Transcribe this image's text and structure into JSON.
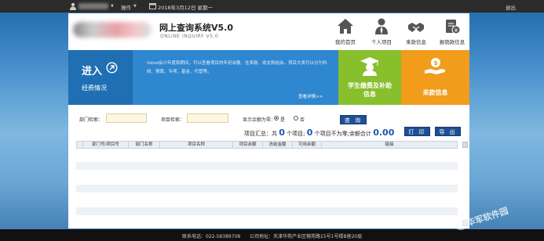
{
  "topbar": {
    "operate_label": "操作",
    "date": "2018年3月12日 星期一",
    "logout_label": "退出"
  },
  "header": {
    "title": "网上查询系统V5.0",
    "subtitle": "ONLINE INQUIRY V5.0",
    "nav": [
      {
        "label": "我的首页",
        "icon": "home-icon"
      },
      {
        "label": "个人项目",
        "icon": "person-icon"
      },
      {
        "label": "来款信息",
        "icon": "handshake-icon"
      },
      {
        "label": "报销款信息",
        "icon": "receipt-icon"
      }
    ]
  },
  "banner": {
    "enter_label": "进入",
    "section_label": "经费情况",
    "description": "listed会计年度和期间，可以查看项目的年初余额、往来款、收支和结余。项目大类可以分为科研、预算、专项、基金、代管等。",
    "more_label": "查看详情>>",
    "tiles": [
      {
        "label": "学生缴费及补助信息",
        "color": "#88bf2c",
        "icon": "graduate-icon"
      },
      {
        "label": "来款信息",
        "color": "#f19c1b",
        "icon": "money-hand-icon"
      }
    ]
  },
  "filters": {
    "dept_label": "部门检索：",
    "dept_value": "",
    "project_label": "项目检索：",
    "project_value": "",
    "zero_label": "显示余额为零：",
    "yes_label": "是",
    "no_label": "否",
    "selected": "是",
    "query_button": "查 询",
    "print_button": "打 印",
    "export_button": "导 出"
  },
  "summary": {
    "prefix": "项目汇总：共",
    "count": "0",
    "mid": "个项目;",
    "zero_count": "0",
    "mid2": "个项目不为零;余额合计",
    "total": "0.00",
    "suffix": "。"
  },
  "table": {
    "columns": [
      "部门号/项目号",
      "部门名称",
      "项目名称",
      "项目余额",
      "冻结金额",
      "可用余额",
      "链接"
    ],
    "rows": []
  },
  "footer": {
    "phone": "联系电话：022-58389708",
    "address": "公司地址：天津华苑产业区榕苑路15号1号楼B座20层"
  },
  "watermark": "华军软件园"
}
